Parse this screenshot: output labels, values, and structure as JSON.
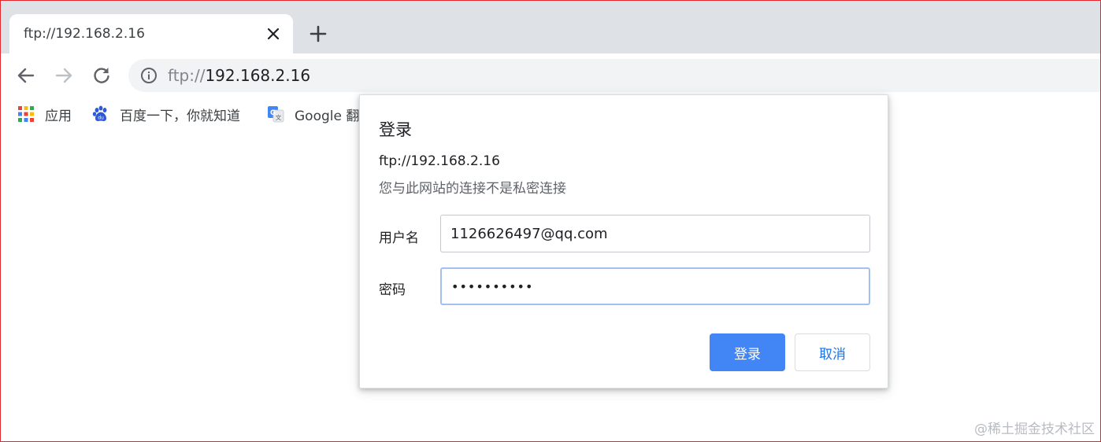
{
  "browser": {
    "tab": {
      "title": "ftp://192.168.2.16"
    },
    "address_bar": {
      "scheme": "ftp://",
      "host": "192.168.2.16"
    },
    "bookmarks": [
      {
        "label": "应用",
        "icon": "apps-grid-icon"
      },
      {
        "label": "百度一下，你就知道",
        "icon": "baidu-paw-icon"
      },
      {
        "label": "Google 翻",
        "icon": "google-translate-icon"
      }
    ]
  },
  "dialog": {
    "title": "登录",
    "origin": "ftp://192.168.2.16",
    "warning": "您与此网站的连接不是私密连接",
    "username_label": "用户名",
    "username_value": "1126626497@qq.com",
    "password_label": "密码",
    "password_value": "••••••••••",
    "login_button": "登录",
    "cancel_button": "取消"
  },
  "watermark": "@稀土掘金技术社区",
  "colors": {
    "accent": "#4285f4",
    "link": "#1a73e8",
    "tabstrip": "#dee1e6",
    "omnibox": "#f1f3f4",
    "focus_ring": "#a3c0ee"
  }
}
